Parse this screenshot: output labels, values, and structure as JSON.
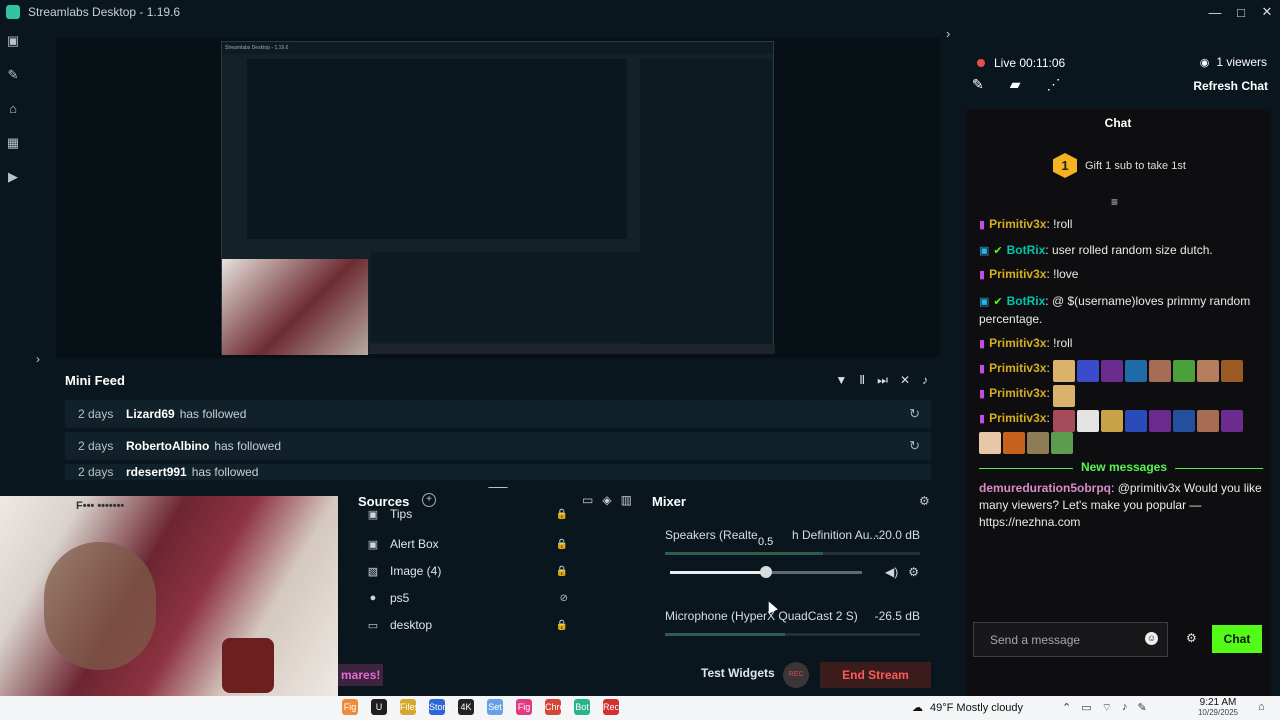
{
  "window": {
    "title": "Streamlabs Desktop - 1.19.6",
    "controls": [
      "—",
      "□",
      "✕"
    ]
  },
  "leftnav": {
    "icons": [
      "studio-icon",
      "theme-icon",
      "store-icon",
      "alerts-icon",
      "recordings-icon"
    ]
  },
  "preview": {
    "inner_title": "Streamlabs Desktop - 1.19.6"
  },
  "minifeed": {
    "title": "Mini Feed",
    "items": [
      {
        "age": "2 days",
        "name": "Lizard69",
        "action": "has followed"
      },
      {
        "age": "2 days",
        "name": "RobertoAlbino",
        "action": "has followed"
      },
      {
        "age": "2 days",
        "name": "rdesert991",
        "action": "has followed"
      }
    ]
  },
  "sources": {
    "title": "Sources",
    "items": [
      {
        "name": "Tips",
        "icon": "▣"
      },
      {
        "name": "Alert Box",
        "icon": "▣"
      },
      {
        "name": "Image (4)",
        "icon": "▧"
      },
      {
        "name": "ps5",
        "icon": "●"
      },
      {
        "name": "desktop",
        "icon": "▭"
      }
    ]
  },
  "mixer": {
    "title": "Mixer",
    "rows": [
      {
        "name": "Speakers (Realte",
        "name_tail": "h Definition Au...",
        "db": "-20.0 dB",
        "level": 0.62
      },
      {
        "name": "Microphone (HyperX QuadCast 2 S)",
        "db": "-26.5 dB",
        "level": 0.47
      }
    ],
    "slider_value": "0.5",
    "slider_level": 0.5
  },
  "footer": {
    "widget_pill": "mares!",
    "test_widgets": "Test Widgets",
    "rec": "REC",
    "end_stream": "End Stream"
  },
  "webcam": {
    "partial_text": "F••• •••••••"
  },
  "chat_panel": {
    "live": "Live 00:11:06",
    "viewers": "1 viewers",
    "refresh": "Refresh Chat",
    "chat_title": "Chat",
    "gift_badge": "1",
    "gift_text": "Gift 1 sub to take 1st",
    "messages": [
      {
        "user": "Primitiv3x",
        "text": "!roll"
      },
      {
        "user": "BotRix",
        "text": "user rolled random size dutch."
      },
      {
        "user": "Primitiv3x",
        "text": "!love"
      },
      {
        "user": "BotRix",
        "text": "@ $(username)loves primmy random percentage."
      },
      {
        "user": "Primitiv3x",
        "text": "!roll"
      },
      {
        "user": "Primitiv3x",
        "text": ""
      },
      {
        "user": "Primitiv3x",
        "text": ""
      },
      {
        "user": "Primitiv3x",
        "text": ""
      }
    ],
    "new_messages": "New messages",
    "last_message": {
      "user": "demureduration5obrpq",
      "text": "@primitiv3x Would you like many viewers? Let's make you popular — https://nezhna.com"
    },
    "placeholder": "Send a message",
    "send_button": "Chat"
  },
  "taskbar": {
    "apps": [
      "Fig",
      "U",
      "Files",
      "Store",
      "4K",
      "Set",
      "Fig",
      "Chrome",
      "Bot",
      "Rec"
    ],
    "weather": "49°F  Mostly cloudy",
    "time": "9:21 AM",
    "date": "10/29/2025"
  },
  "colors": {
    "bg": "#09161d",
    "accent": "#31c3a2",
    "live": "#eb4c4c",
    "kick": "#53fc18"
  }
}
